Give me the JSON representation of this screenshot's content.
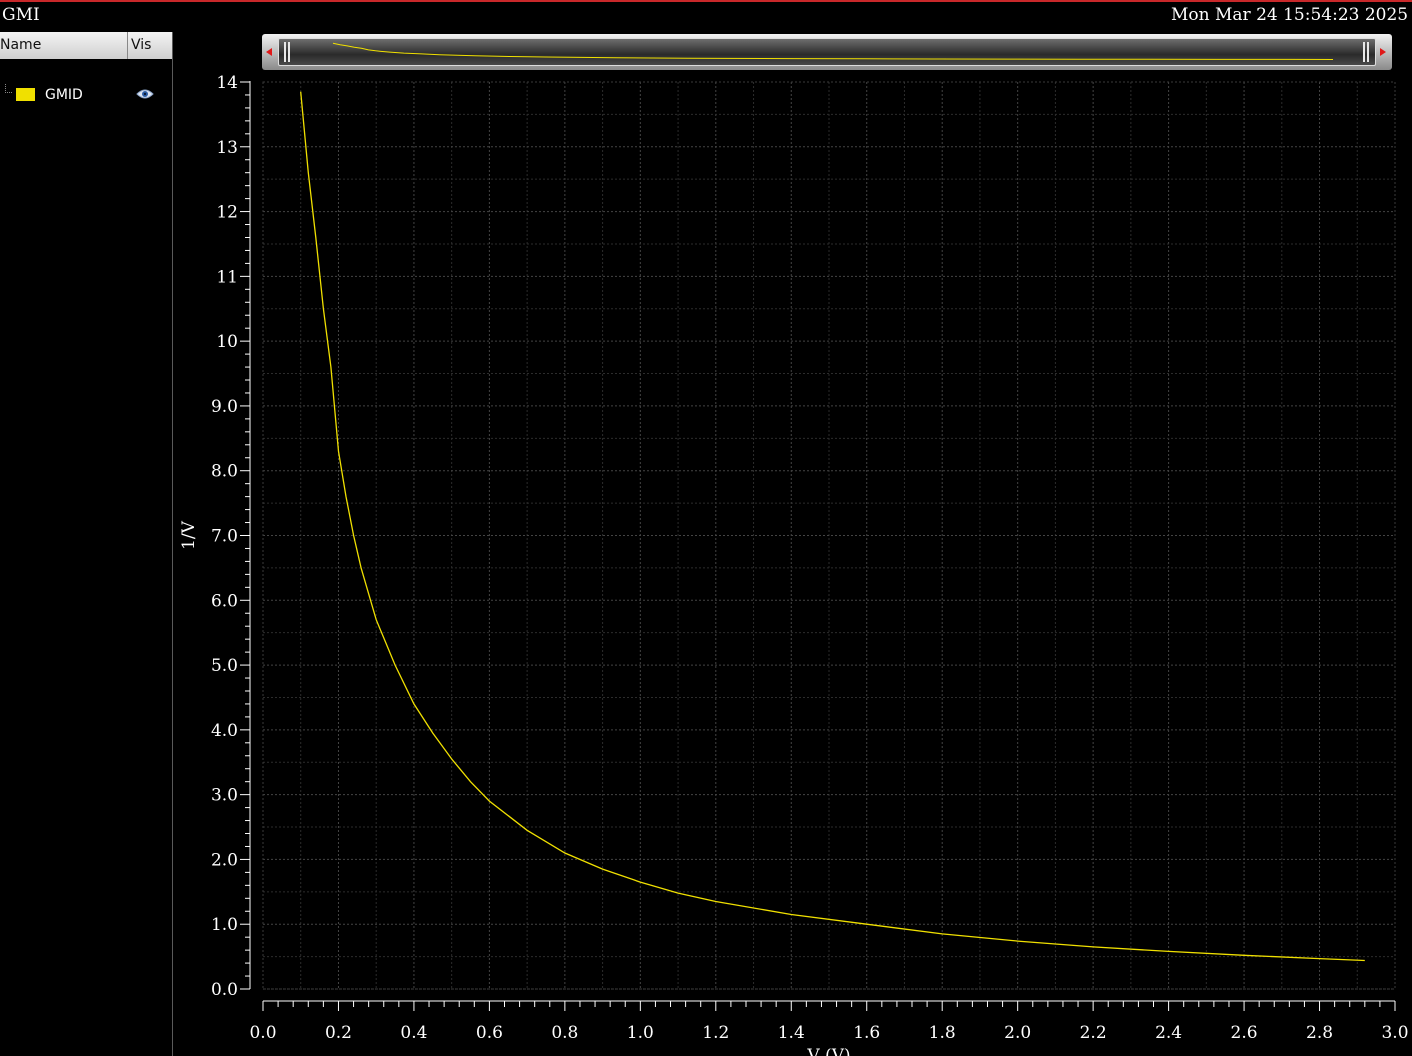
{
  "window": {
    "title": "GMI",
    "timestamp": "Mon Mar 24 15:54:23 2025"
  },
  "signal_list": {
    "columns": {
      "name": "Name",
      "visible": "Vis"
    },
    "items": [
      {
        "label": "GMID",
        "color": "#f0e000",
        "visible_icon": "eye-icon"
      }
    ]
  },
  "scroller": {
    "left_arrow_icon": "arrow-left-icon",
    "right_arrow_icon": "arrow-right-icon"
  },
  "chart_data": {
    "type": "line",
    "title": "",
    "xlabel": "V (V)",
    "ylabel": "1/V",
    "xlim": [
      0.0,
      3.0
    ],
    "ylim": [
      0.0,
      14.0
    ],
    "grid": true,
    "x_ticks": [
      0.0,
      0.2,
      0.4,
      0.6,
      0.8,
      1.0,
      1.2,
      1.4,
      1.6,
      1.8,
      2.0,
      2.2,
      2.4,
      2.6,
      2.8,
      3.0
    ],
    "x_tick_labels": [
      "0.0",
      "0.2",
      "0.4",
      "0.6",
      "0.8",
      "1.0",
      "1.2",
      "1.4",
      "1.6",
      "1.8",
      "2.0",
      "2.2",
      "2.4",
      "2.6",
      "2.8",
      "3.0"
    ],
    "y_ticks": [
      0,
      1,
      2,
      3,
      4,
      5,
      6,
      7,
      8,
      9,
      10,
      11,
      12,
      13,
      14
    ],
    "y_tick_labels": [
      "0.0",
      "1.0",
      "2.0",
      "3.0",
      "4.0",
      "5.0",
      "6.0",
      "7.0",
      "8.0",
      "9.0",
      "10",
      "11",
      "12",
      "13",
      "14"
    ],
    "series": [
      {
        "name": "GMID",
        "color": "#f0e000",
        "x": [
          0.1,
          0.12,
          0.14,
          0.16,
          0.18,
          0.2,
          0.22,
          0.24,
          0.26,
          0.3,
          0.35,
          0.4,
          0.45,
          0.5,
          0.55,
          0.6,
          0.7,
          0.8,
          0.9,
          1.0,
          1.1,
          1.2,
          1.4,
          1.6,
          1.8,
          2.0,
          2.2,
          2.4,
          2.6,
          2.8,
          2.92
        ],
        "y": [
          13.85,
          12.6,
          11.6,
          10.5,
          9.6,
          8.3,
          7.6,
          7.0,
          6.5,
          5.7,
          5.0,
          4.4,
          3.95,
          3.55,
          3.2,
          2.9,
          2.45,
          2.1,
          1.85,
          1.65,
          1.48,
          1.35,
          1.15,
          1.0,
          0.85,
          0.74,
          0.65,
          0.58,
          0.52,
          0.47,
          0.44
        ]
      }
    ]
  }
}
